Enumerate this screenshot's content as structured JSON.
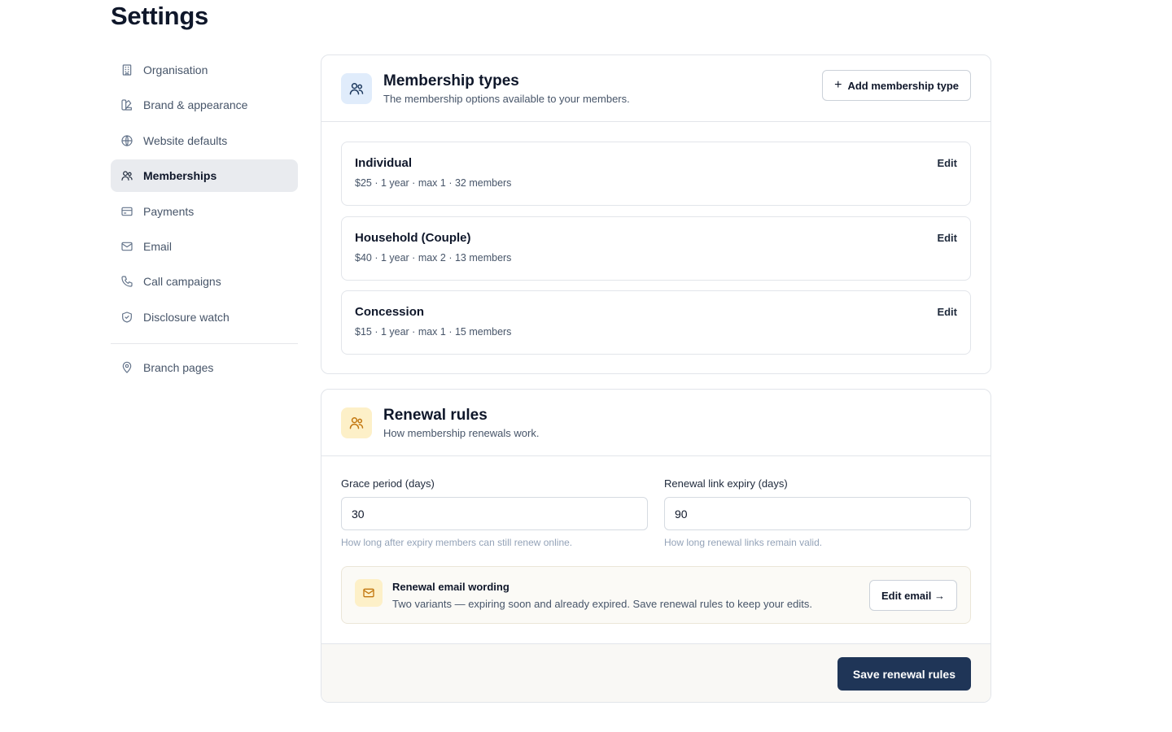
{
  "page": {
    "title": "Settings"
  },
  "sidebar": {
    "items": [
      {
        "label": "Organisation",
        "icon": "building-icon"
      },
      {
        "label": "Brand & appearance",
        "icon": "palette-icon"
      },
      {
        "label": "Website defaults",
        "icon": "globe-icon"
      },
      {
        "label": "Memberships",
        "icon": "users-icon",
        "active": true
      },
      {
        "label": "Payments",
        "icon": "credit-card-icon"
      },
      {
        "label": "Email",
        "icon": "mail-icon"
      },
      {
        "label": "Call campaigns",
        "icon": "phone-icon"
      },
      {
        "label": "Disclosure watch",
        "icon": "shield-check-icon"
      }
    ],
    "secondary": [
      {
        "label": "Branch pages",
        "icon": "map-pin-icon"
      }
    ]
  },
  "membership_types": {
    "title": "Membership types",
    "subtitle": "The membership options available to your members.",
    "add_button": "Add membership type",
    "items": [
      {
        "name": "Individual",
        "meta": "$25 · 1 year · max 1 · 32 members",
        "edit": "Edit"
      },
      {
        "name": "Household (Couple)",
        "meta": "$40 · 1 year · max 2 · 13 members",
        "edit": "Edit"
      },
      {
        "name": "Concession",
        "meta": "$15 · 1 year · max 1 · 15 members",
        "edit": "Edit"
      }
    ]
  },
  "renewal_rules": {
    "title": "Renewal rules",
    "subtitle": "How membership renewals work.",
    "grace": {
      "label": "Grace period (days)",
      "value": "30",
      "help": "How long after expiry members can still renew online."
    },
    "expiry": {
      "label": "Renewal link expiry (days)",
      "value": "90",
      "help": "How long renewal links remain valid."
    },
    "email": {
      "title": "Renewal email wording",
      "description": "Two variants — expiring soon and already expired. Save renewal rules to keep your edits.",
      "button": "Edit email →"
    },
    "save_button": "Save renewal rules"
  },
  "colors": {
    "primary": "#1f3557",
    "amber": "#c2770f",
    "blue_tint": "#e0ecfb",
    "amber_tint": "#fdf0c8"
  }
}
